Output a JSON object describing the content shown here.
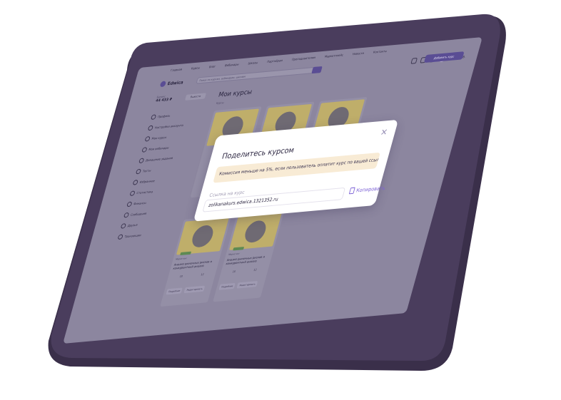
{
  "topbar": {
    "nav": [
      "Главная",
      "Курсы",
      "Блог",
      "Вебинары",
      "Школы",
      "Партнёрам",
      "Преподавателям",
      "Маркетплейс",
      "Новости",
      "Контакты"
    ],
    "user_name": "Дмитрий В."
  },
  "header": {
    "logo": "Edwica",
    "search_placeholder": "Поиск по курсам, вебинарам, школам",
    "add_course_label": "Добавить курс"
  },
  "sidebar": {
    "balance_label": "Баланс",
    "balance_value": "44 433 ₽",
    "withdraw_label": "Вывести",
    "items": [
      "Профиль",
      "Настройки аккаунта",
      "Мои курсы",
      "Мои вебинары",
      "Домашние задания",
      "Тесты",
      "Избранное",
      "Статистика",
      "Финансы",
      "Сообщения",
      "Друзья",
      "Транзакции"
    ]
  },
  "main": {
    "title": "Мои курсы",
    "subtitle": "Курсы",
    "cards": [
      {
        "category": "Маркетинг",
        "title": "Анализ рыночных рисков и конкурентный анализ",
        "stat1": "10",
        "stat2": "12",
        "btn1": "Подробнее",
        "btn2": "Редактировать"
      },
      {
        "category": "Маркетинг",
        "title": "Анализ рыночных рисков и конкурентный анализ",
        "stat1": "10",
        "stat2": "12",
        "btn1": "Подробнее",
        "btn2": "Редактировать"
      }
    ]
  },
  "modal": {
    "title": "Поделитесь курсом",
    "notice": "Комиссия меньше на 5%, если пользователь оплатит курс по вашей ссылке.",
    "field_label": "Ссылка на курс",
    "field_value": "zolikanakurs.edwica.1321352.ru",
    "copy_label": "Копировать"
  },
  "colors": {
    "tablet_frame": "#4a3d5d",
    "tablet_edge": "#3a2f4a",
    "overlay": "#8c869f",
    "accent": "#7d62d6",
    "notice_bg": "#f8ebd5"
  }
}
